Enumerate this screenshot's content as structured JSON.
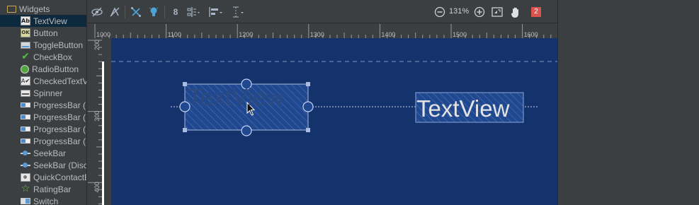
{
  "palette": {
    "section_title": "Widgets",
    "items": [
      {
        "label": "TextView",
        "icon": "textview-icon",
        "selected": true
      },
      {
        "label": "Button",
        "icon": "button-icon"
      },
      {
        "label": "ToggleButton",
        "icon": "toggle-button-icon"
      },
      {
        "label": "CheckBox",
        "icon": "checkbox-icon"
      },
      {
        "label": "RadioButton",
        "icon": "radio-button-icon"
      },
      {
        "label": "CheckedTextView",
        "icon": "checked-textview-icon"
      },
      {
        "label": "Spinner",
        "icon": "spinner-icon"
      },
      {
        "label": "ProgressBar (Large)",
        "icon": "progressbar-icon"
      },
      {
        "label": "ProgressBar (Normal)",
        "icon": "progressbar-icon"
      },
      {
        "label": "ProgressBar (Small)",
        "icon": "progressbar-icon"
      },
      {
        "label": "ProgressBar (Horizontal)",
        "icon": "progressbar-icon"
      },
      {
        "label": "SeekBar",
        "icon": "seekbar-icon"
      },
      {
        "label": "SeekBar (Discrete)",
        "icon": "seekbar-icon"
      },
      {
        "label": "QuickContactBadge",
        "icon": "quick-contact-icon"
      },
      {
        "label": "RatingBar",
        "icon": "rating-bar-icon"
      },
      {
        "label": "Switch",
        "icon": "switch-icon"
      }
    ]
  },
  "toolbar": {
    "default_margin": "8",
    "zoom_level": "131%",
    "error_count": "2",
    "icons": [
      "show-constraints-icon",
      "autoconnect-icon",
      "clear-constraints-icon",
      "infer-constraints-icon",
      "default-margins-icon",
      "pack-icon",
      "align-icon",
      "guidelines-icon",
      "zoom-out-icon",
      "zoom-in-icon",
      "zoom-to-fit-icon",
      "pan-icon",
      "error-badge"
    ]
  },
  "ruler": {
    "horizontal": [
      "1000",
      "1100",
      "1200",
      "1300",
      "1400",
      "1500",
      "1600"
    ],
    "vertical": [
      "200",
      "300",
      "400"
    ]
  },
  "design": {
    "background_color": "#14336d",
    "widgets": [
      {
        "name": "textview-selected",
        "text": "TextView",
        "selected": true
      },
      {
        "name": "textview-second",
        "text": "TextView",
        "selected": false
      }
    ]
  }
}
